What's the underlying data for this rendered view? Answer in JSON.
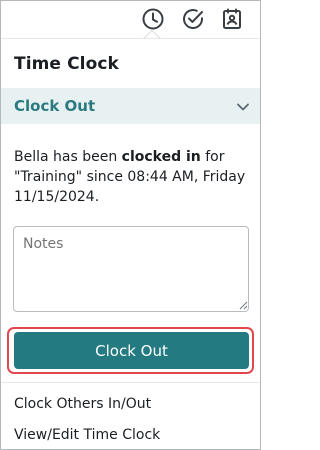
{
  "topbar": {
    "icons": [
      "clock-icon",
      "check-circle-icon",
      "calendar-person-icon"
    ]
  },
  "title": "Time Clock",
  "section": {
    "label": "Clock Out",
    "chevron": "chevron-down-icon"
  },
  "status": {
    "name": "Bella",
    "text_1": " has been ",
    "bold_1": "clocked in",
    "text_2": " for \"Training\" since 08:44 AM, Friday 11/15/2024."
  },
  "notes": {
    "placeholder": "Notes",
    "value": ""
  },
  "primary_button": {
    "label": "Clock Out"
  },
  "links": {
    "clock_others": "Clock Others In/Out",
    "view_edit": "View/Edit Time Clock"
  },
  "colors": {
    "accent": "#237a80",
    "section_bg": "#e8f1f2",
    "focus_ring": "#e0484e"
  }
}
